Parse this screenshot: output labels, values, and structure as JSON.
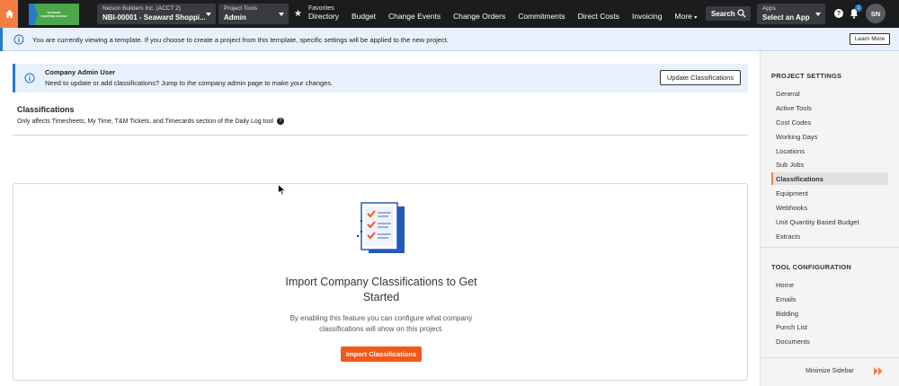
{
  "topnav": {
    "company": "Nelson Builders Inc. (ACCT 2)",
    "project": "NBI-00001 - Seaward Shoppi...",
    "tools_small": "Project Tools",
    "tools_big": "Admin",
    "favorites_label": "Favorites",
    "nav_items": [
      "Directory",
      "Budget",
      "Change Events",
      "Change Orders",
      "Commitments",
      "Direct Costs",
      "Invoicing",
      "More"
    ],
    "search_label": "Search",
    "apps_small": "Apps",
    "apps_big": "Select an App",
    "help_glyph": "?",
    "notification_count": "1",
    "avatar_initials": "SN",
    "logo_text": "SEAWARD SHOPPING CENTER"
  },
  "template_banner": {
    "text": "You are currently viewing a template. If you choose to create a project from this template, specific settings will be applied to the new project.",
    "learn_more": "Learn More"
  },
  "admin_banner": {
    "title": "Company Admin User",
    "text": "Need to update or add classifications? Jump to the company admin page to make your changes.",
    "button": "Update Classifications"
  },
  "classifications": {
    "title": "Classifications",
    "subtitle": "Only affects Timesheets, My Time, T&M Tickets, and Timecards section of the Daily Log tool",
    "help_glyph": "?"
  },
  "empty_state": {
    "title": "Import Company Classifications to Get Started",
    "description": "By enabling this feature you can configure what company classifications will show on this project.",
    "button": "Import Classifications"
  },
  "sidebar": {
    "project_settings_heading": "PROJECT SETTINGS",
    "project_settings_items": [
      "General",
      "Active Tools",
      "Cost Codes",
      "Working Days",
      "Locations",
      "Sub Jobs",
      "Classifications",
      "Equipment",
      "Webhooks",
      "Unit Quantity Based Budget",
      "Extracts"
    ],
    "active_item": "Classifications",
    "tool_config_heading": "TOOL CONFIGURATION",
    "tool_config_items": [
      "Home",
      "Emails",
      "Bidding",
      "Punch List",
      "Documents"
    ],
    "minimize_label": "Minimize Sidebar"
  },
  "colors": {
    "accent_orange": "#f47e42",
    "button_orange": "#f1581a",
    "info_blue": "#2a79c9",
    "nav_dark": "#1b1c1e"
  }
}
